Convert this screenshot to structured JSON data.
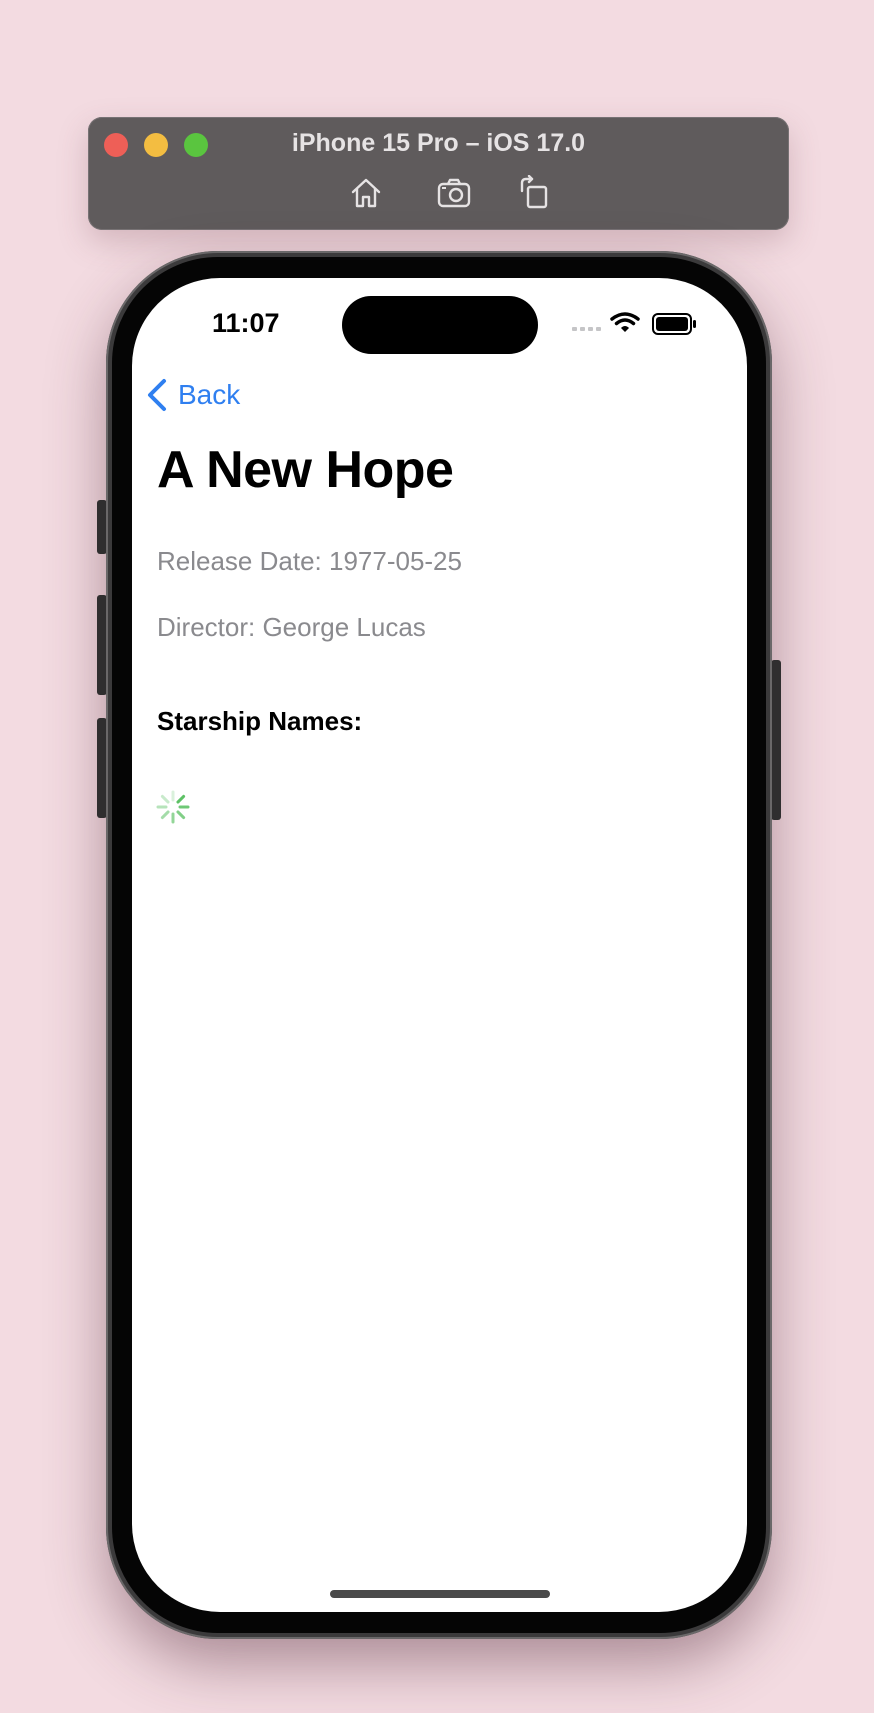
{
  "simulator": {
    "title": "iPhone 15 Pro – iOS 17.0",
    "toolbar_icons": [
      "home-icon",
      "screenshot-icon",
      "rotate-icon"
    ]
  },
  "status_bar": {
    "time": "11:07",
    "icons": [
      "signal-icon",
      "wifi-icon",
      "battery-icon"
    ]
  },
  "nav": {
    "back_label": "Back",
    "accent": "#2f7ff0"
  },
  "film": {
    "title": "A New Hope",
    "release_line": "Release Date: 1977-05-25",
    "director_line": "Director: George Lucas",
    "starships_label": "Starship Names:"
  },
  "loading": {
    "spinner_color": "#4cbb55"
  }
}
